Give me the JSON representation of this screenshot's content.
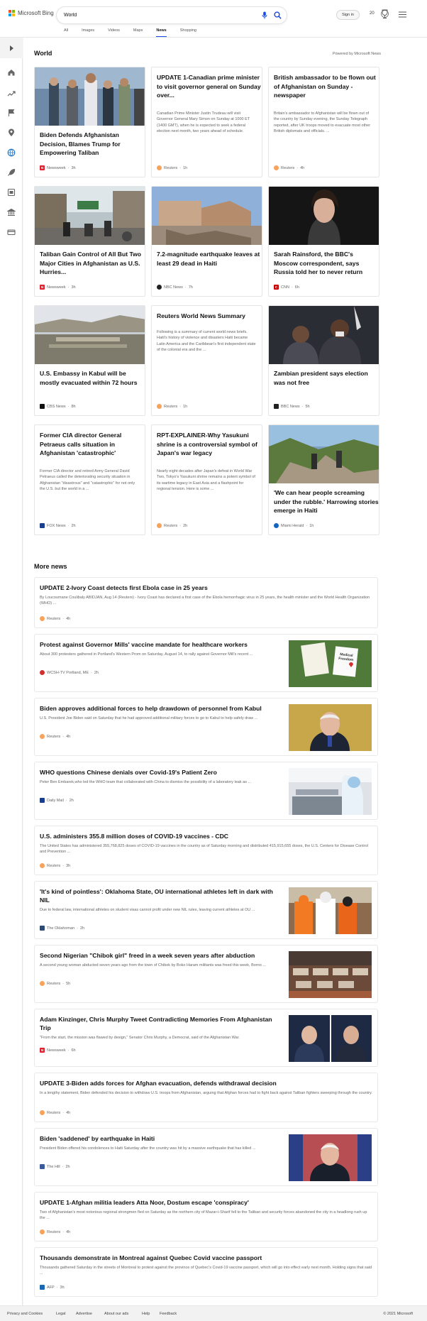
{
  "header": {
    "brand": "Microsoft Bing",
    "search_value": "World",
    "sign_in": "Sign in",
    "points": "20",
    "tabs": [
      {
        "label": "All"
      },
      {
        "label": "Images"
      },
      {
        "label": "Videos"
      },
      {
        "label": "Maps"
      },
      {
        "label": "News"
      },
      {
        "label": "Shopping"
      }
    ]
  },
  "section": {
    "title": "World",
    "powered": "Powered by Microsoft News"
  },
  "cards": [
    {
      "title": "Biden Defends Afghanistan Decision, Blames Trump for Empowering Taliban",
      "snippet": "",
      "source": "Newsweek",
      "time": "3h"
    },
    {
      "title": "UPDATE 1-Canadian prime minister to visit governor general on Sunday over...",
      "snippet": "Canadian Prime Minister Justin Trudeau will visit Governor General Mary Simon on Sunday at 1000 ET (1400 GMT), when he is expected to seek a federal election next month, two years ahead of schedule.",
      "source": "Reuters",
      "time": "1h"
    },
    {
      "title": "British ambassador to be flown out of Afghanistan on Sunday - newspaper",
      "snippet": "Britain's ambassador to Afghanistan will be flown out of the country by Sunday evening, the Sunday Telegraph reported, after UK troops moved to evacuate most other British diplomats and officials. ...",
      "source": "Reuters",
      "time": "4h"
    },
    {
      "title": "Taliban Gain Control of All But Two Major Cities in Afghanistan as U.S. Hurries...",
      "snippet": "",
      "source": "Newsweek",
      "time": "3h"
    },
    {
      "title": "7.2-magnitude earthquake leaves at least 29 dead in Haiti",
      "snippet": "",
      "source": "NBC News",
      "time": "7h"
    },
    {
      "title": "Sarah Rainsford, the BBC's Moscow correspondent, says Russia told her to never return",
      "snippet": "",
      "source": "CNN",
      "time": "6h"
    },
    {
      "title": "U.S. Embassy in Kabul will be mostly evacuated within 72 hours",
      "snippet": "",
      "source": "CBS News",
      "time": "8h"
    },
    {
      "title": "Reuters World News Summary",
      "snippet": "Following is a summary of current world news briefs. Haiti's history of violence and disasters Haiti became Latin America and the Caribbean's first independent state of the colonial era and the ...",
      "source": "Reuters",
      "time": "1h"
    },
    {
      "title": "Zambian president says election was not free",
      "snippet": "",
      "source": "BBC News",
      "time": "5h"
    },
    {
      "title": "Former CIA director General Petraeus calls situation in Afghanistan 'catastrophic'",
      "snippet": "Former CIA director and retired Army General David Petraeus called the deteriorating security situation in Afghanistan \"disastrous\" and \"catastrophic\" for not only the U.S. but the world in a ...",
      "source": "FOX News",
      "time": "2h"
    },
    {
      "title": "RPT-EXPLAINER-Why Yasukuni shrine is a controversial symbol of Japan's war legacy",
      "snippet": "Nearly eight decades after Japan's defeat in World War Two, Tokyo's Yasukuni shrine remains a potent symbol of its wartime legacy in East Asia and a flashpoint for regional tension. Here is some ...",
      "source": "Reuters",
      "time": "2h"
    },
    {
      "title": "'We can hear people screaming under the rubble.' Harrowing stories emerge in Haiti",
      "snippet": "",
      "source": "Miami Herald",
      "time": "1h"
    }
  ],
  "more_news": {
    "title": "More news",
    "items": [
      {
        "title": "UPDATE 2-Ivory Coast detects first Ebola case in 25 years",
        "snippet": "By Loucoumane Coulibaly ABIDJAN, Aug 14 (Reuters) - Ivory Coast has declared a first case of the Ebola hemorrhagic virus in 25 years, the health minister and the World Health Organization (WHO) ...",
        "source": "Reuters",
        "time": "4h"
      },
      {
        "title": "Protest against Governor Mills' vaccine mandate for healthcare workers",
        "snippet": "About 300 protesters gathered in Portland's Western Prom on Saturday, August 14, to rally against Governor Mill's recent ...",
        "source": "WCSH-TV Portland, ME",
        "time": "2h"
      },
      {
        "title": "Biden approves additional forces to help drawdown of personnel from Kabul",
        "snippet": "U.S. President Joe Biden said on Saturday that he had approved additional military forces to go to Kabul to help safely draw ...",
        "source": "Reuters",
        "time": "4h"
      },
      {
        "title": "WHO questions Chinese denials over Covid-19's Patient Zero",
        "snippet": "Peter Ben Embarek,who led the WHO team that collaborated with China to dismiss the possibility of a laboratory leak as ...",
        "source": "Daily Mail",
        "time": "2h"
      },
      {
        "title": "U.S. administers 355.8 million doses of COVID-19 vaccines - CDC",
        "snippet": "The United States has administered 355,768,825 doses of COVID-19 vaccines in the country as of Saturday morning and distributed 415,915,655 doses, the U.S. Centers for Disease Control and Prevention ...",
        "source": "Reuters",
        "time": "3h"
      },
      {
        "title": "'It's kind of pointless': Oklahoma State, OU international athletes left in dark with NIL",
        "snippet": "Due to federal law, international athletes on student visas cannot profit under new NIL rules, leaving current athletes at OU ...",
        "source": "The Oklahoman",
        "time": "2h"
      },
      {
        "title": "Second Nigerian \"Chibok girl\" freed in a week seven years after abduction",
        "snippet": "A second young woman abducted seven years ago from the town of Chibok by Boko Haram militants was freed this week, Borno ...",
        "source": "Reuters",
        "time": "5h"
      },
      {
        "title": "Adam Kinzinger, Chris Murphy Tweet Contradicting Memories From Afghanistan Trip",
        "snippet": "\"From the start, the mission was flawed by design,\" Senator Chris Murphy, a Democrat, said of the Afghanistan War.",
        "source": "Newsweek",
        "time": "6h"
      },
      {
        "title": "UPDATE 3-Biden adds forces for Afghan evacuation, defends withdrawal decision",
        "snippet": "In a lengthy statement, Biden defended his decision to withdraw U.S. troops from Afghanistan, arguing that Afghan forces had to fight back against Taliban fighters sweeping through the country.",
        "source": "Reuters",
        "time": "4h"
      },
      {
        "title": "Biden 'saddened' by earthquake in Haiti",
        "snippet": "President Biden offered his condolences to Haiti Saturday after the country was hit by a massive earthquake that has killed ...",
        "source": "The Hill",
        "time": "2h"
      },
      {
        "title": "UPDATE 1-Afghan militia leaders Atta Noor, Dostum escape 'conspiracy'",
        "snippet": "Two of Afghanistan's most notorious regional strongmen fled on Saturday as the northern city of Mazar-i-Sharif fell to the Taliban and security forces abandoned the city in a headlong rush up the ...",
        "source": "Reuters",
        "time": "4h"
      },
      {
        "title": "Thousands demonstrate in Montreal against Quebec Covid vaccine passport",
        "snippet": "Thousands gathered Saturday in the streets of Montreal to protest against the province of Quebec's Covid-19 vaccine passport, which will go into effect early next month. Holding signs that said ...",
        "source": "AFP",
        "time": "3h"
      }
    ]
  },
  "protest_sign": "Medical Freedom",
  "footer": {
    "links": [
      "Privacy and Cookies",
      "Legal",
      "Advertise",
      "About our ads",
      "Help",
      "Feedback"
    ],
    "copyright": "© 2021 Microsoft"
  }
}
